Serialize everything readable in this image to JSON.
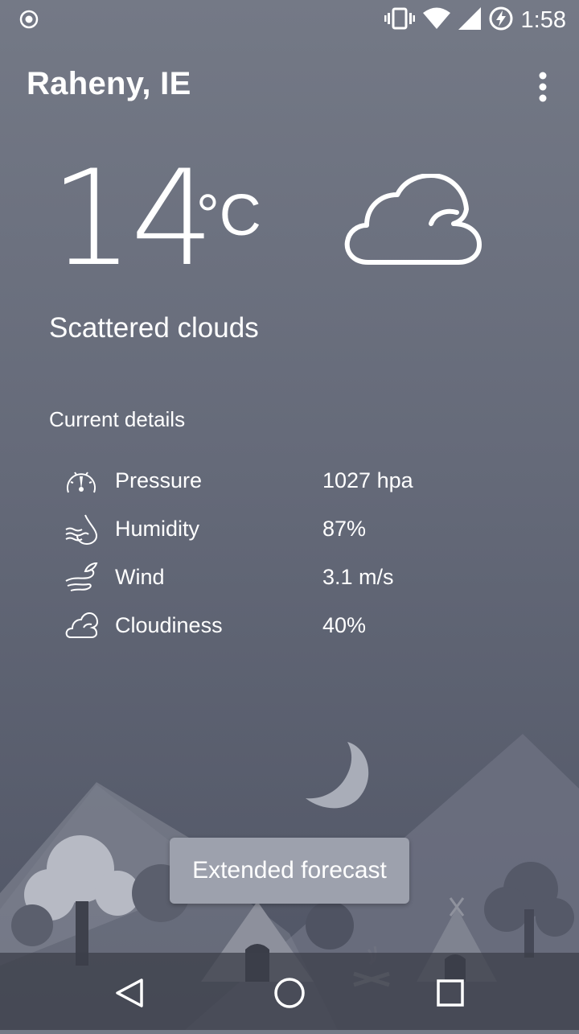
{
  "status_bar": {
    "time": "1:58",
    "icons": [
      "record-icon",
      "vibrate-icon",
      "wifi-icon",
      "signal-icon",
      "battery-charging-icon"
    ]
  },
  "app_bar": {
    "location": "Raheny, IE",
    "menu_icon": "more-vert-icon"
  },
  "current": {
    "temperature": "14",
    "unit": "°C",
    "condition_icon": "cloud-icon",
    "description": "Scattered clouds"
  },
  "details": {
    "title": "Current details",
    "rows": [
      {
        "icon": "pressure-gauge-icon",
        "label": "Pressure",
        "value": "1027 hpa"
      },
      {
        "icon": "humidity-icon",
        "label": "Humidity",
        "value": "87%"
      },
      {
        "icon": "wind-icon",
        "label": "Wind",
        "value": "3.1 m/s"
      },
      {
        "icon": "cloudiness-icon",
        "label": "Cloudiness",
        "value": "40%"
      }
    ]
  },
  "toast": {
    "label": "Extended forecast"
  },
  "nav_bar": {
    "buttons": [
      "back-icon",
      "home-icon",
      "recents-icon"
    ]
  },
  "colors": {
    "background_top": "#747986",
    "background_bottom": "#4f5464",
    "toast_bg": "#9da1ad"
  }
}
